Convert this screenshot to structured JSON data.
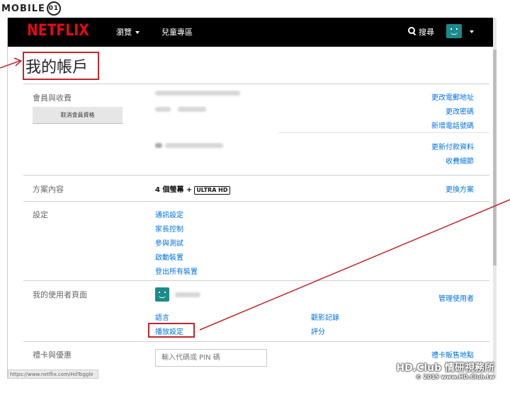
{
  "watermark_top": {
    "text": "MOBILE",
    "ring": "01"
  },
  "nav": {
    "logo": "NETFLIX",
    "browse": "瀏覽",
    "kids": "兒童專區",
    "search": "搜尋"
  },
  "page": {
    "title": "我的帳戶"
  },
  "membership": {
    "label": "會員與收費",
    "cancel_button": "取消會員資格",
    "links": [
      "更改電郵地址",
      "更改密碼",
      "新增電話號碼",
      "更新付款資料",
      "收費細節"
    ]
  },
  "plan": {
    "label": "方案內容",
    "screens": "4 個螢幕 +",
    "badge": "ULTRA HD",
    "change_link": "更換方案"
  },
  "settings": {
    "label": "設定",
    "links": [
      "通訊設定",
      "家長控制",
      "參與測試",
      "啟動裝置",
      "登出所有裝置"
    ]
  },
  "profile": {
    "label": "我的使用者頁面",
    "manage_link": "管理使用者",
    "links_left": [
      "語言",
      "播放設定"
    ],
    "links_right": [
      "觀影記錄",
      "評分"
    ]
  },
  "gift": {
    "label": "禮卡與優惠",
    "input_placeholder": "輸入代碼或 PIN 碼",
    "link": "禮卡販售地點"
  },
  "status_bar": {
    "url": "https://www.netflix.com/HdToggle"
  },
  "watermark_bottom": {
    "line1": "HD.Club 情研視務所",
    "line2": "© 2015  www.HD.Club.tw"
  },
  "colors": {
    "brand": "#e50914",
    "link": "#0073e6",
    "annotation": "#c0272d",
    "avatar": "#1c8a8a"
  }
}
